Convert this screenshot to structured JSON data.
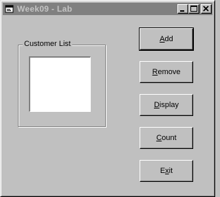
{
  "window": {
    "title": "Week09 - Lab",
    "icon": "form-icon",
    "controls": [
      "minimize-icon",
      "maximize-icon",
      "close-icon"
    ]
  },
  "frame": {
    "label": "Customer List"
  },
  "buttons": [
    {
      "name": "add-button",
      "label": "Add",
      "accel_index": 0,
      "default": true
    },
    {
      "name": "remove-button",
      "label": "Remove",
      "accel_index": 0,
      "default": false
    },
    {
      "name": "display-button",
      "label": "Display",
      "accel_index": 0,
      "default": false
    },
    {
      "name": "count-button",
      "label": "Count",
      "accel_index": 0,
      "default": false
    },
    {
      "name": "exit-button",
      "label": "Exit",
      "accel_index": 1,
      "default": false
    }
  ],
  "colors": {
    "face": "#c0c0c0",
    "inactive_title": "#808080",
    "listbox": "#ffffff"
  }
}
